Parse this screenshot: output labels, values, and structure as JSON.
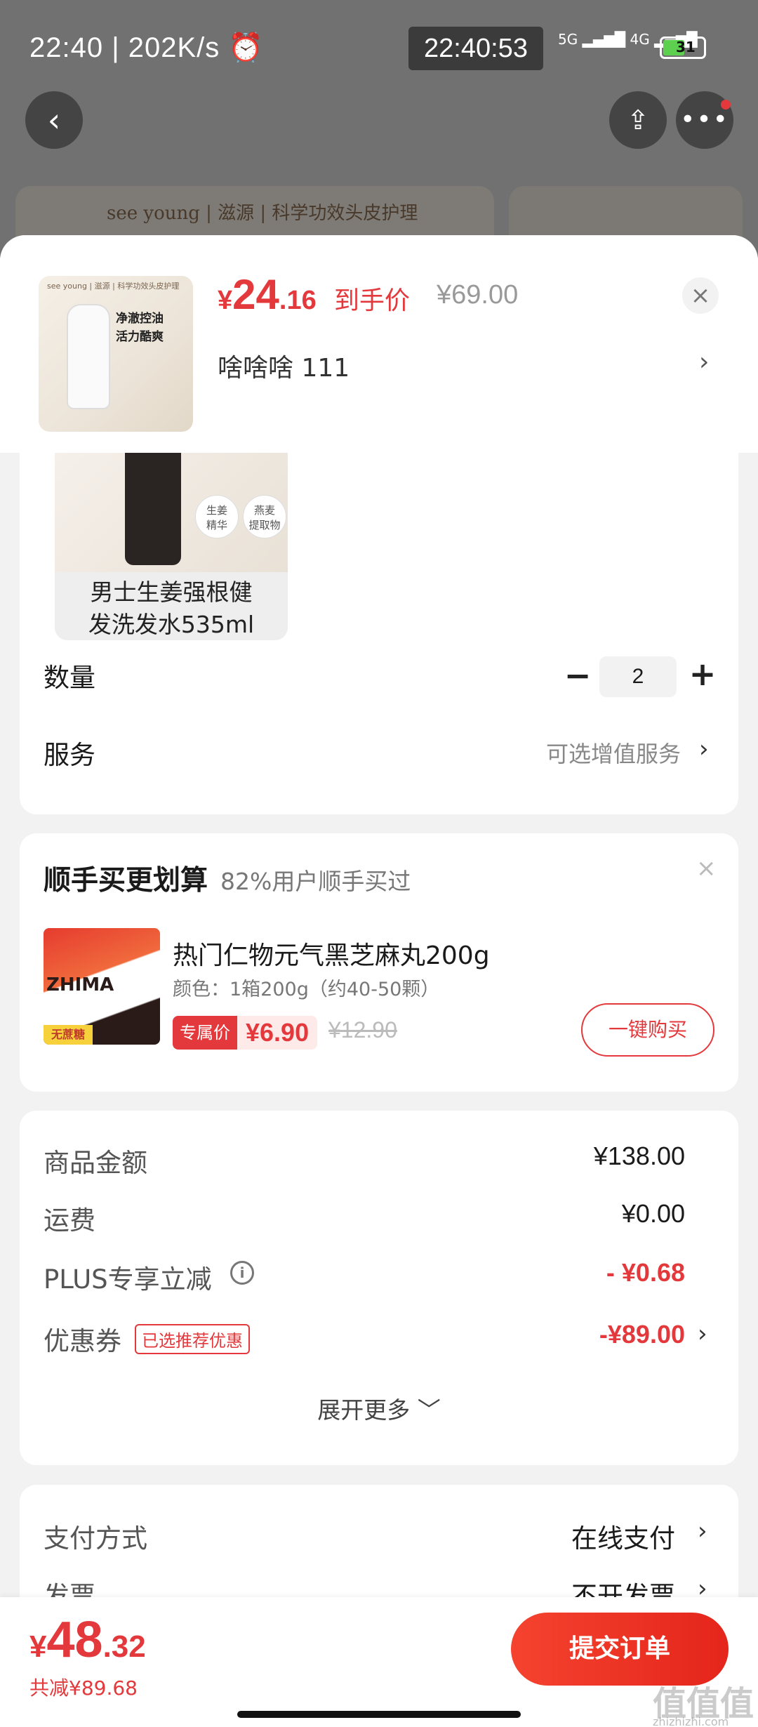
{
  "status_bar": {
    "time": "22:40",
    "net_speed": "202K/s",
    "clock_overlay": "22:40:53",
    "net_type_1": "5G",
    "net_type_2": "4G",
    "battery": "31"
  },
  "banner": {
    "text": "see young | 滋源 | 科学功效头皮护理"
  },
  "product": {
    "thumb_brand": "see young | 滋源 | 科学功效头皮护理",
    "thumb_line1": "净澈控油",
    "thumb_line2": "活力酷爽",
    "price_currency": "¥",
    "price_int": "24",
    "price_dec": ".16",
    "price_label": "到手价",
    "price_original": "¥69.00",
    "selected_spec": "啥啥啥   111",
    "close_icon": "close-icon"
  },
  "sku": {
    "circle1": "生姜\n精华",
    "circle2": "燕麦\n提取物",
    "name_line1": "男士生姜强根健",
    "name_line2": "发洗发水535ml"
  },
  "quantity": {
    "label": "数量",
    "value": "2",
    "minus": "−",
    "plus": "+"
  },
  "service": {
    "label": "服务",
    "hint": "可选增值服务"
  },
  "addon": {
    "title": "顺手买更划算",
    "subtitle": "82%用户顺手买过",
    "product_name": "热门仁物元气黑芝麻丸200g",
    "spec": "颜色：1箱200g（约40-50颗）",
    "exclusive_tag": "专属价",
    "exclusive_price": "¥6.90",
    "original_price": "¥12.90",
    "img_text": "ZHIMA",
    "img_badge": "无蔗糖",
    "button": "一键购买"
  },
  "summary": {
    "rows": [
      {
        "label": "商品金额",
        "value": "¥138.00"
      },
      {
        "label": "运费",
        "value": "¥0.00"
      },
      {
        "label": "PLUS专享立减",
        "value": "- ¥0.68"
      },
      {
        "label": "优惠券",
        "value": "-¥89.00"
      }
    ],
    "coupon_badge": "已选推荐优惠",
    "expand": "展开更多 ﹀"
  },
  "payment": {
    "method_label": "支付方式",
    "method_value": "在线支付",
    "invoice_label": "发票",
    "invoice_value": "不开发票"
  },
  "bottom": {
    "currency": "¥",
    "total_int": "48",
    "total_dec": ".32",
    "saved": "共减¥89.68",
    "submit": "提交订单"
  },
  "watermark": {
    "main": "值值值",
    "sub": "zhizhizhi.com"
  },
  "colors": {
    "accent": "#e4393c",
    "background": "#f2f2f2",
    "card": "#ffffff"
  }
}
